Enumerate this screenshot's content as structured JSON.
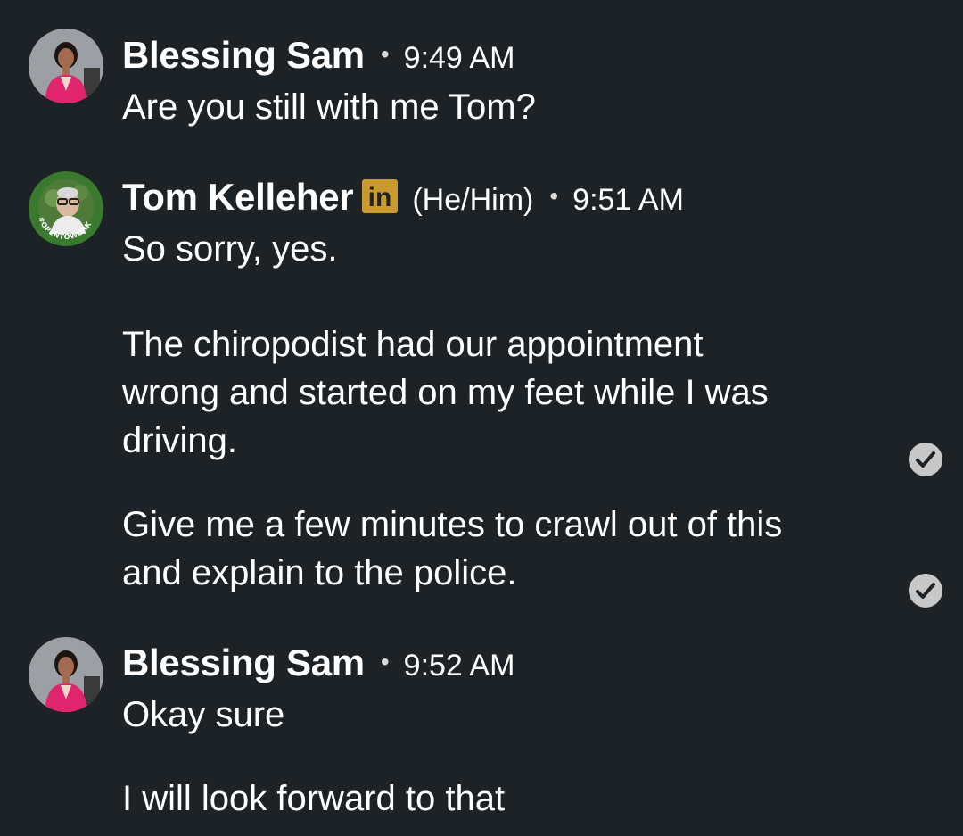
{
  "messages": [
    {
      "sender": "Blessing Sam",
      "time": "9:49 AM",
      "text": "Are you still with me Tom?"
    },
    {
      "sender": "Tom Kelleher",
      "badge": "in",
      "pronouns": "(He/Him)",
      "time": "9:51 AM",
      "avatar_frame_text": "#OPENTOWORK",
      "paragraphs": [
        "So sorry, yes.",
        "The chiropodist had our appointment\nwrong and started on my feet while I was\ndriving.",
        "Give me a few minutes to crawl out of this\nand explain to the police."
      ]
    },
    {
      "sender": "Blessing Sam",
      "time": "9:52 AM",
      "paragraphs": [
        "Okay sure",
        "I will look forward to that"
      ]
    }
  ],
  "separator": "•",
  "icons": {
    "read_receipt": "check-circle-icon",
    "linkedin_badge": "linkedin-icon"
  },
  "colors": {
    "background": "#1d2226",
    "text": "#ffffff",
    "linkedin_badge": "#c99a2e",
    "open_to_work_frame": "#3a7a2f",
    "read_receipt": "#c8c8c8"
  }
}
